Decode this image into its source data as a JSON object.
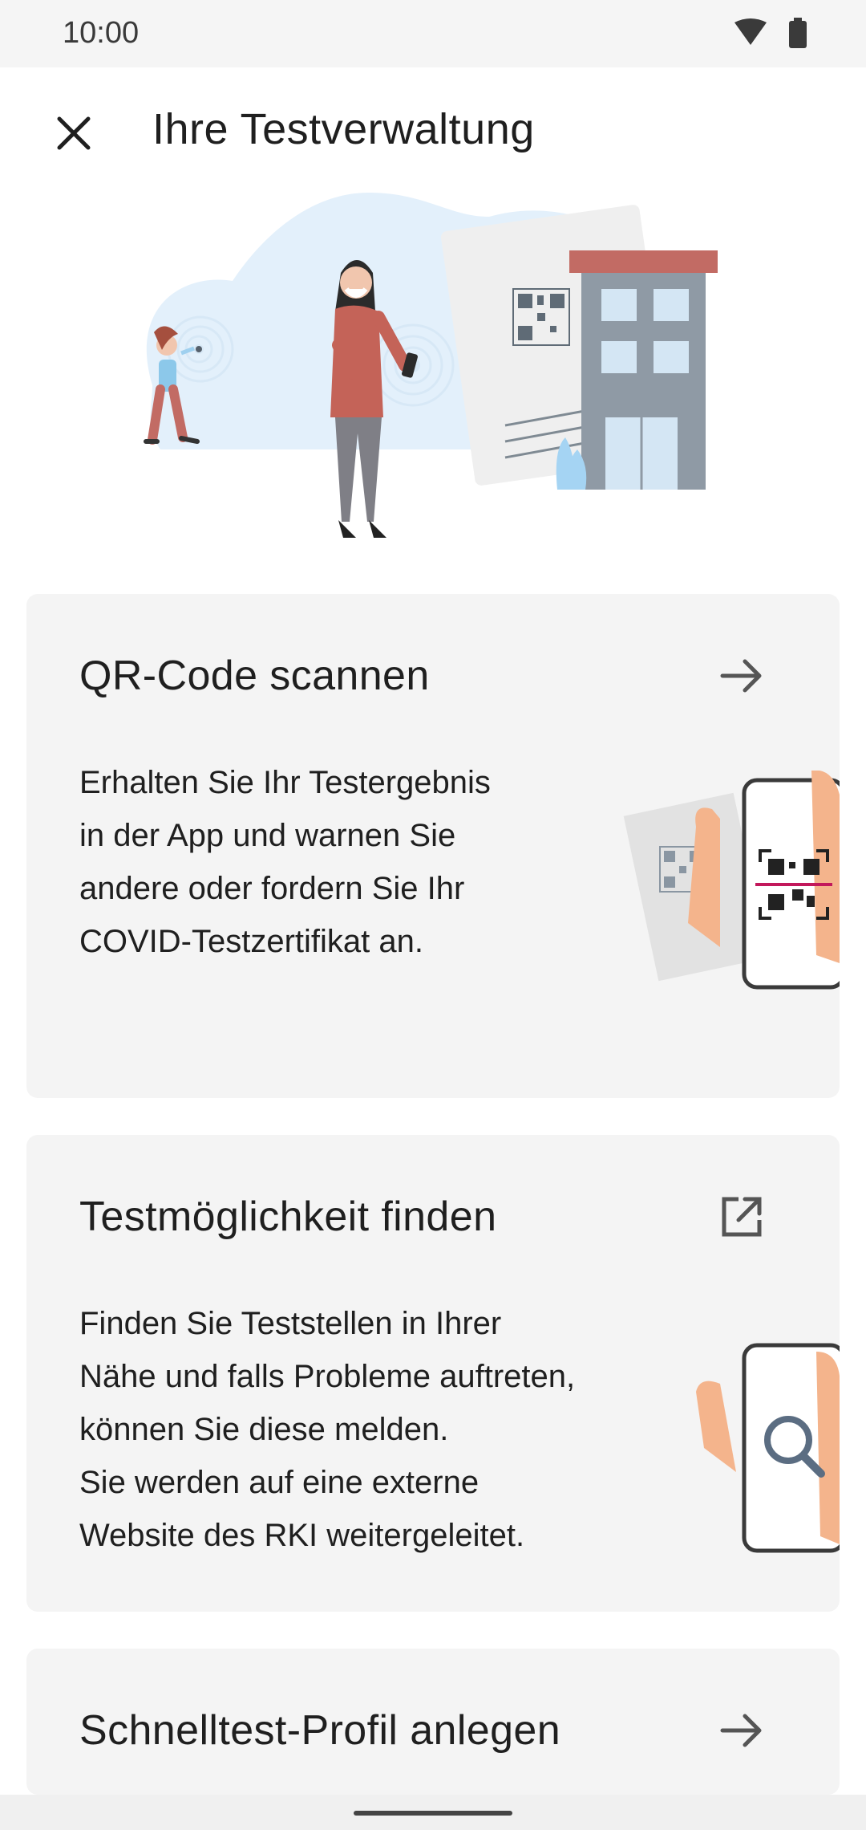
{
  "status_bar": {
    "time": "10:00",
    "icons": [
      "wifi-icon",
      "battery-icon"
    ]
  },
  "toolbar": {
    "close_icon": "close-icon",
    "title": "Ihre Testverwaltung"
  },
  "cards": [
    {
      "title": "QR-Code scannen",
      "body": "Erhalten Sie Ihr Testergebnis\nin der App und warnen Sie\nandere oder fordern Sie Ihr\nCOVID-Testzertifikat an.",
      "action_icon": "arrow-right-icon"
    },
    {
      "title": "Testmöglichkeit finden",
      "body": "Finden Sie Teststellen in Ihrer\nNähe und falls Probleme auftreten,\nkönnen Sie diese melden.\nSie werden auf eine externe\nWebsite des RKI weitergeleitet.",
      "action_icon": "open-external-icon"
    },
    {
      "title": "Schnelltest-Profil anlegen",
      "action_icon": "arrow-right-icon"
    }
  ],
  "colors": {
    "card_bg": "#f4f4f4",
    "accent_red": "#c26b64",
    "building_gray": "#8f9aa5",
    "hero_blob": "#e3f0fb",
    "skin": "#f4b48c"
  }
}
